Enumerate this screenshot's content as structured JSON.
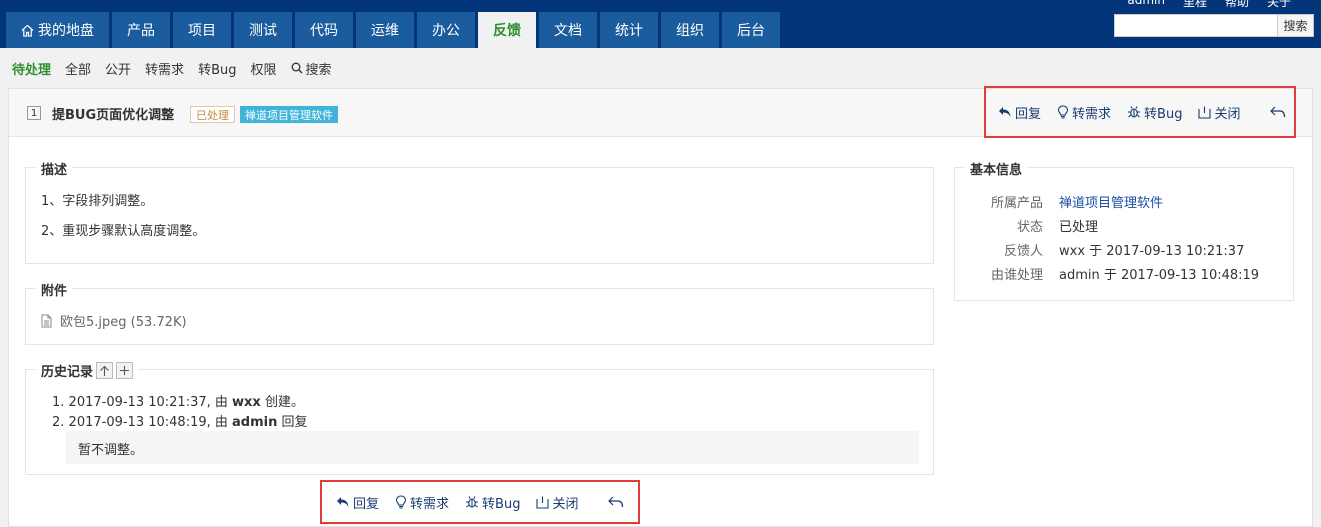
{
  "topnav": {
    "tabs": [
      {
        "label": "我的地盘",
        "icon": "home-icon"
      },
      {
        "label": "产品"
      },
      {
        "label": "项目"
      },
      {
        "label": "测试"
      },
      {
        "label": "代码"
      },
      {
        "label": "运维"
      },
      {
        "label": "办公"
      },
      {
        "label": "反馈",
        "active": true
      },
      {
        "label": "文档"
      },
      {
        "label": "统计"
      },
      {
        "label": "组织"
      },
      {
        "label": "后台"
      }
    ],
    "user": {
      "name": "admin",
      "links": [
        "里程",
        "帮助",
        "关于"
      ]
    },
    "search": {
      "value": "",
      "button": "搜索"
    }
  },
  "subnav": {
    "items": [
      "待处理",
      "全部",
      "公开",
      "转需求",
      "转Bug",
      "权限",
      "搜索"
    ],
    "active": "待处理",
    "search_icon": "search-icon"
  },
  "feedback": {
    "id": "1",
    "title": "提BUG页面优化调整",
    "status": "已处理",
    "product": "禅道项目管理软件"
  },
  "actions": {
    "reply": "回复",
    "to_story": "转需求",
    "to_bug": "转Bug",
    "close": "关闭",
    "icons": [
      "reply-icon",
      "lightbulb-icon",
      "bug-icon",
      "close-icon",
      "back-icon"
    ]
  },
  "description": {
    "legend": "描述",
    "lines": [
      "1、字段排列调整。",
      "2、重现步骤默认高度调整。"
    ]
  },
  "files": {
    "legend": "附件",
    "items": [
      {
        "name": "欧包5.jpeg (53.72K)",
        "icon": "file-icon"
      }
    ]
  },
  "history": {
    "legend": "历史记录",
    "entries": [
      {
        "num": "1.",
        "time": "2017-09-13 10:21:37, 由",
        "user": "wxx",
        "action": "创建。"
      },
      {
        "num": "2.",
        "time": "2017-09-13 10:48:19, 由",
        "user": "admin",
        "action": "回复"
      }
    ],
    "comment": "暂不调整。"
  },
  "basic_info": {
    "legend": "基本信息",
    "rows": [
      {
        "key": "所属产品",
        "value": "禅道项目管理软件"
      },
      {
        "key": "状态",
        "value": "已处理"
      },
      {
        "key": "反馈人",
        "value": "wxx 于 2017-09-13 10:21:37"
      },
      {
        "key": "由谁处理",
        "value": "admin 于 2017-09-13 10:48:19"
      }
    ]
  },
  "colors": {
    "nav_bg": "#03357a",
    "tab_bg": "#1a5c9e",
    "active_green": "#2f8f2f",
    "badge_product": "#3fb4d8",
    "highlight_border": "#e23b3b"
  }
}
